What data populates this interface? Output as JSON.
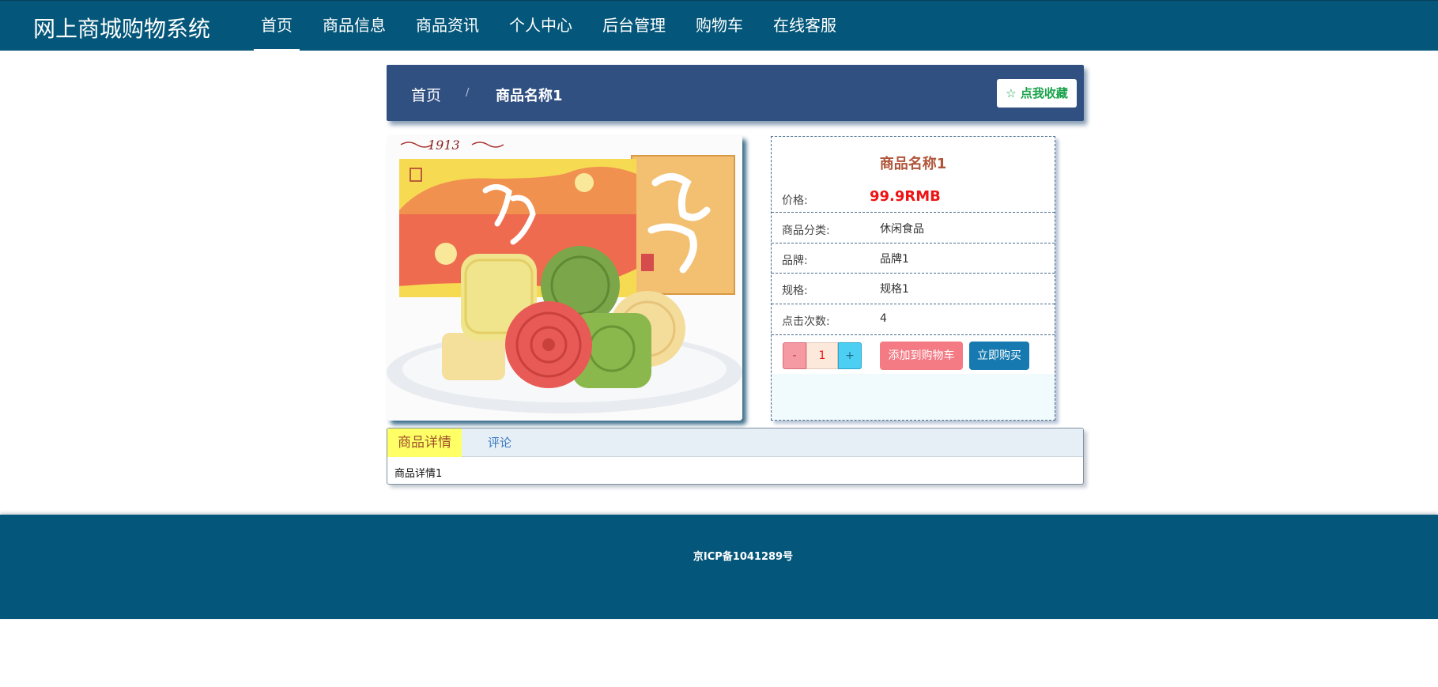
{
  "header": {
    "brand": "网上商城购物系统",
    "nav": [
      {
        "label": "首页",
        "active": true
      },
      {
        "label": "商品信息"
      },
      {
        "label": "商品资讯"
      },
      {
        "label": "个人中心"
      },
      {
        "label": "后台管理"
      },
      {
        "label": "购物车"
      },
      {
        "label": "在线客服"
      }
    ]
  },
  "breadcrumb": {
    "home": "首页",
    "separator": "/",
    "current": "商品名称1",
    "favorite_button": "☆ 点我收藏"
  },
  "product": {
    "image_alt": "1913",
    "name": "商品名称1",
    "price_label": "价格:",
    "price_value": "99.9RMB",
    "rows": [
      {
        "label": "商品分类:",
        "value": "休闲食品"
      },
      {
        "label": "品牌:",
        "value": "品牌1"
      },
      {
        "label": "规格:",
        "value": "规格1"
      },
      {
        "label": "点击次数:",
        "value": "4"
      }
    ],
    "quantity": {
      "minus": "-",
      "value": "1",
      "plus": "+"
    },
    "add_to_cart": "添加到购物车",
    "buy_now": "立即购买"
  },
  "tabs": {
    "detail_tab": "商品详情",
    "comment_tab": "评论",
    "content": "商品详情1"
  },
  "footer": {
    "icp": "京ICP备1041289号"
  },
  "colors": {
    "header_bg": "#04577a",
    "breadcrumb_bg": "#305082",
    "price": "#ef1313",
    "title": "#b0553a"
  }
}
